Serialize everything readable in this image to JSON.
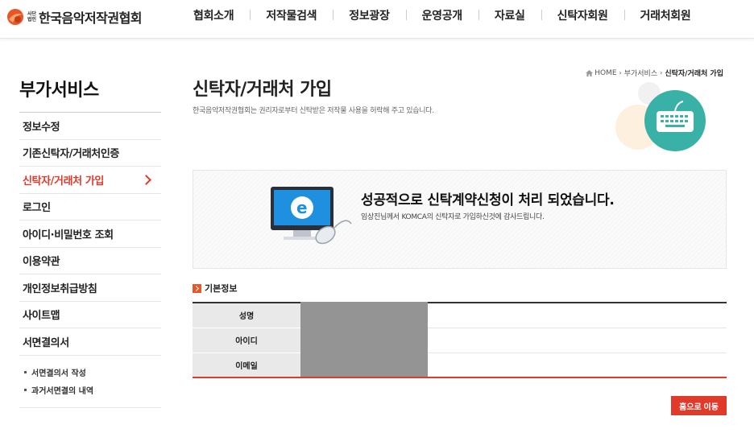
{
  "header": {
    "logo": {
      "prefix_line1": "사단",
      "prefix_line2": "법인",
      "name": "한국음악저작권협회"
    },
    "nav": [
      "협회소개",
      "저작물검색",
      "정보광장",
      "운영공개",
      "자료실",
      "신탁자회원",
      "거래처회원"
    ]
  },
  "sidebar": {
    "title": "부가서비스",
    "items": [
      "정보수정",
      "기존신탁자/거래처인증",
      "신탁자/거래처 가입",
      "로그인",
      "아이디·비밀번호 조회",
      "이용약관",
      "개인정보취급방침",
      "사이트맵",
      "서면결의서"
    ],
    "active_index": 2,
    "sub_items": [
      "서면결의서 작성",
      "과거서면결의 내역"
    ]
  },
  "breadcrumb": {
    "home": "HOME",
    "level1": "부가서비스",
    "current": "신탁자/거래처 가입"
  },
  "page": {
    "title": "신탁자/거래처 가입",
    "description": "한국음악저작권협회는 권리자로부터 신탁받은 저작물 사용을 허락해 주고 있습니다."
  },
  "result": {
    "title": "성공적으로 신탁계약신청이 처리 되었습니다.",
    "message": "임상진님께서 KOMCA의 신탁자로 가입하신것에 감사드립니다."
  },
  "basic_info": {
    "section_title": "기본정보",
    "rows": [
      {
        "label": "성명",
        "value": ""
      },
      {
        "label": "아이디",
        "value": ""
      },
      {
        "label": "이메일",
        "value": ""
      }
    ]
  },
  "buttons": {
    "go_home": "홈으로 이동"
  },
  "colors": {
    "accent": "#e13a2b",
    "teal": "#3ab1a6",
    "logo_orange": "#e8562a"
  }
}
